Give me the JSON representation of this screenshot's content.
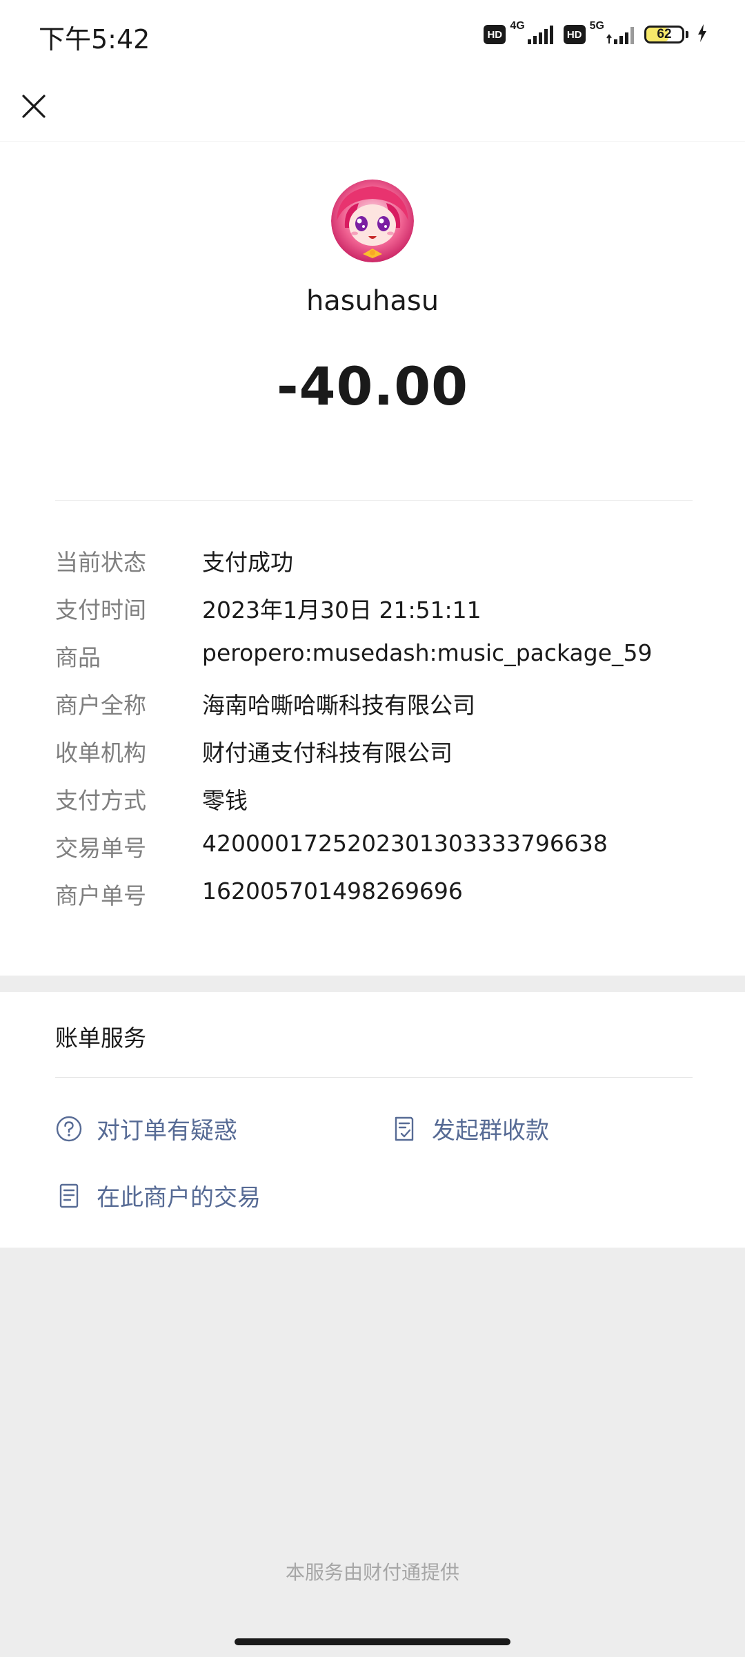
{
  "status_bar": {
    "time": "下午5:42",
    "hd_label": "HD",
    "network_1": "4G",
    "network_2": "5G",
    "battery_percent": "62",
    "battery_level": 0.62
  },
  "header": {
    "close_icon": "close-icon"
  },
  "payment": {
    "payee": "hasuhasu",
    "amount": "-40.00"
  },
  "details": [
    {
      "label": "当前状态",
      "value": "支付成功"
    },
    {
      "label": "支付时间",
      "value": "2023年1月30日 21:51:11"
    },
    {
      "label": "商品",
      "value": "peropero:musedash:music_package_59"
    },
    {
      "label": "商户全称",
      "value": "海南哈嘶哈嘶科技有限公司"
    },
    {
      "label": "收单机构",
      "value": "财付通支付科技有限公司"
    },
    {
      "label": "支付方式",
      "value": "零钱"
    },
    {
      "label": "交易单号",
      "value": "4200001725202301303333796638"
    },
    {
      "label": "商户单号",
      "value": "162005701498269696"
    }
  ],
  "services": {
    "title": "账单服务",
    "links": [
      {
        "label": "对订单有疑惑",
        "icon": "question-circle-icon"
      },
      {
        "label": "发起群收款",
        "icon": "group-collect-icon"
      },
      {
        "label": "在此商户的交易",
        "icon": "document-list-icon"
      }
    ]
  },
  "footer": {
    "credit": "本服务由财付通提供"
  },
  "colors": {
    "link": "#576b95",
    "label": "#7f7f7f",
    "background": "#ededed",
    "avatar_accent": "#e8336f"
  }
}
